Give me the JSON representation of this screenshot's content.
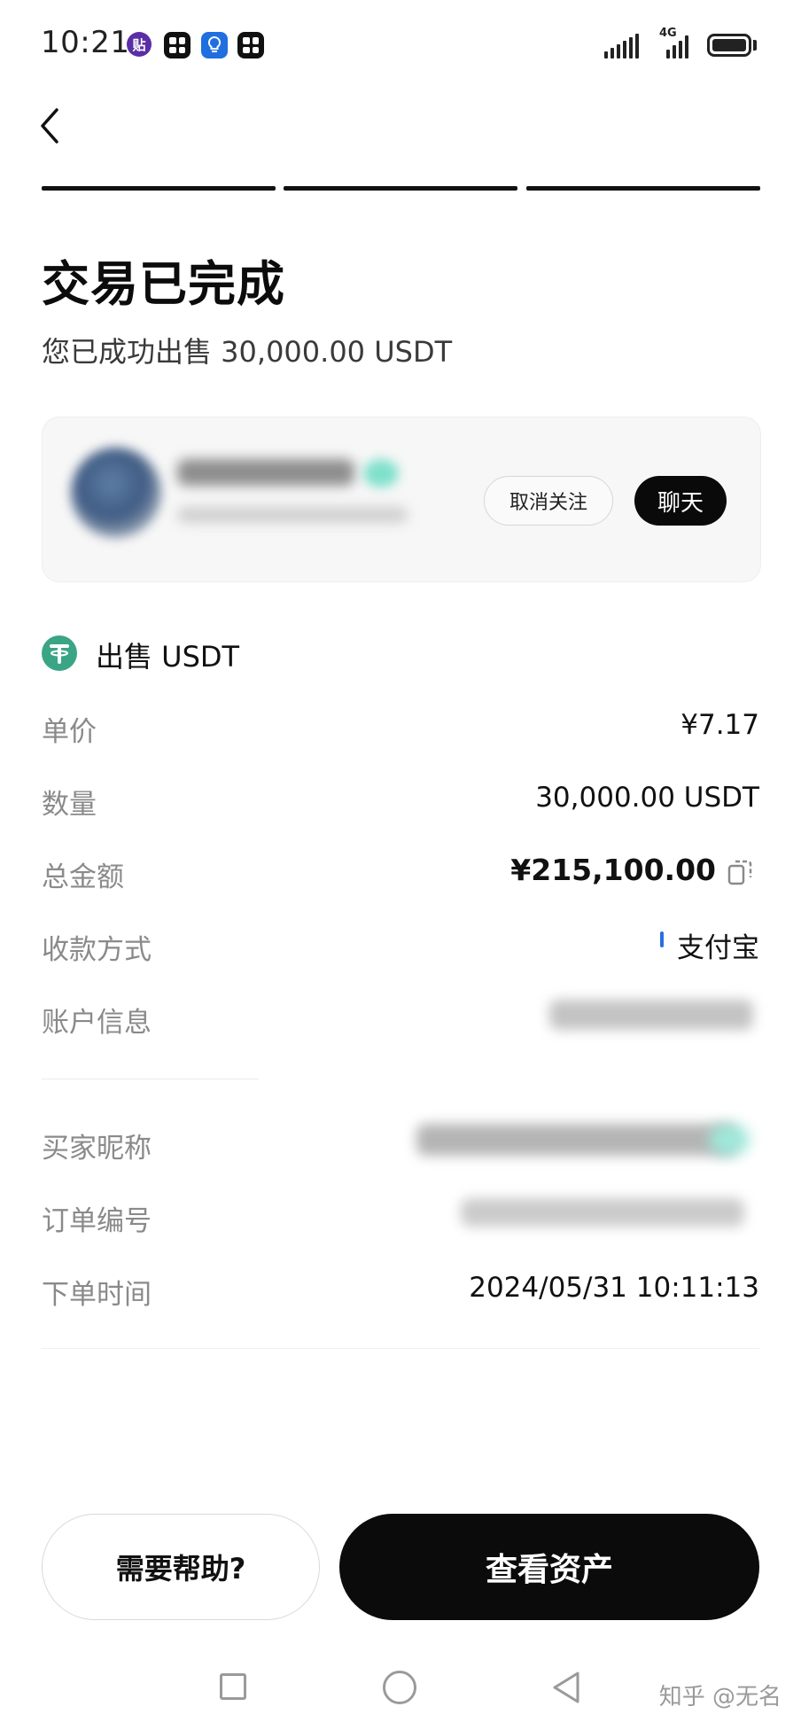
{
  "status_bar": {
    "time": "10:21",
    "network": "4G",
    "app_icons": [
      "tieba-icon",
      "app-grid-icon",
      "bulb-app-icon",
      "app-grid-icon"
    ]
  },
  "header": {
    "back_icon": "chevron-left-icon",
    "progress_steps": 3
  },
  "main": {
    "title": "交易已完成",
    "subtitle": "您已成功出售 30,000.00 USDT"
  },
  "counterparty_card": {
    "unfollow_label": "取消关注",
    "chat_label": "聊天"
  },
  "asset": {
    "icon": "tether-icon",
    "label": "出售 USDT"
  },
  "details": {
    "unit_price": {
      "label": "单价",
      "value": "¥7.17"
    },
    "quantity": {
      "label": "数量",
      "value": "30,000.00 USDT"
    },
    "total": {
      "label": "总金额",
      "value": "¥215,100.00"
    },
    "payment_method": {
      "label": "收款方式",
      "value": "支付宝"
    },
    "account_info": {
      "label": "账户信息"
    },
    "buyer_nickname": {
      "label": "买家昵称"
    },
    "order_number": {
      "label": "订单编号"
    },
    "order_time": {
      "label": "下单时间",
      "value": "2024/05/31 10:11:13"
    }
  },
  "actions": {
    "help_label": "需要帮助?",
    "view_assets_label": "查看资产"
  },
  "nav_bar": {
    "icons": [
      "recent-apps-icon",
      "home-icon",
      "back-triangle-icon"
    ]
  },
  "watermark": "知乎 @无名",
  "colors": {
    "accent_dark": "#0a0a0a",
    "tether_green": "#3aa585",
    "alipay_blue": "#2b6de0",
    "label_gray": "#8a8a8a"
  }
}
